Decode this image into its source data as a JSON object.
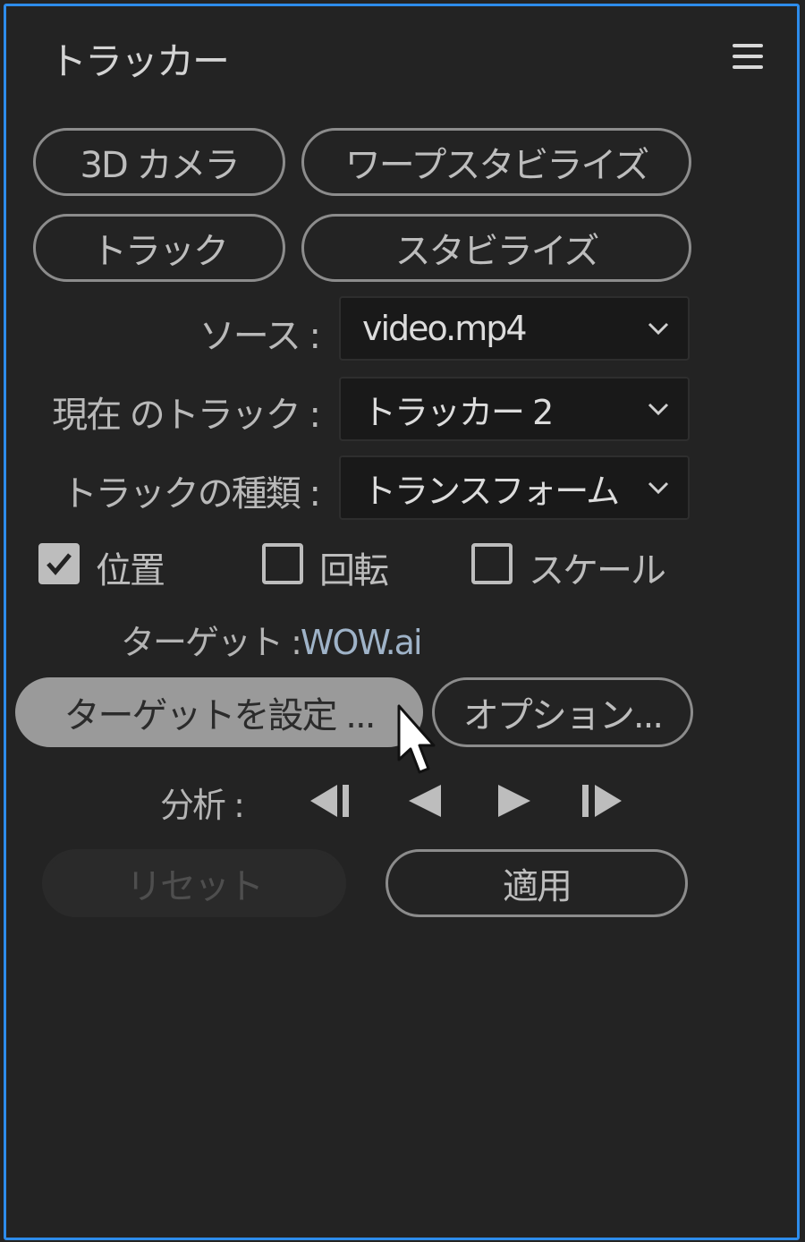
{
  "panel": {
    "title": "トラッカー",
    "menu_icon": "hamburger-menu-icon"
  },
  "buttons": {
    "camera_3d": "3D カメラ",
    "warp_stabilize": "ワープスタビライズ",
    "track": "トラック",
    "stabilize": "スタビライズ",
    "set_target": "ターゲットを設定 ...",
    "options": "オプション...",
    "reset": "リセット",
    "apply": "適用"
  },
  "fields": {
    "source": {
      "label": "ソース :",
      "value": "video.mp4"
    },
    "current_track": {
      "label": "現在 のトラック :",
      "value": "トラッカー 2"
    },
    "track_type": {
      "label": "トラックの種類 :",
      "value": "トランスフォーム"
    }
  },
  "checkboxes": [
    {
      "label": "位置",
      "checked": true
    },
    {
      "label": "回転",
      "checked": false
    },
    {
      "label": "スケール",
      "checked": false
    }
  ],
  "target": {
    "label": "ターゲット :",
    "value": "WOW.ai"
  },
  "analyze": {
    "label": "分析 :",
    "controls": [
      "step-backward-icon",
      "play-backward-icon",
      "play-forward-icon",
      "step-forward-icon"
    ]
  },
  "colors": {
    "accent_border": "#2d8ceb",
    "panel_bg": "#232323",
    "highlight_button": "#9a9a9a"
  }
}
